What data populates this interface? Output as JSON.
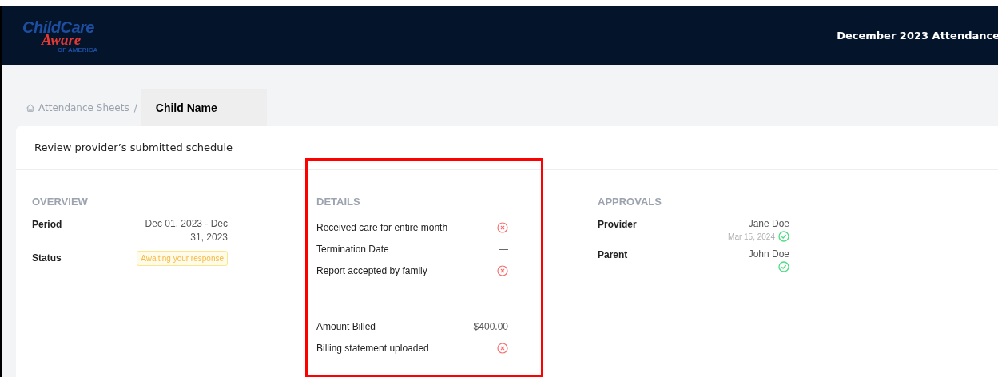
{
  "header": {
    "logo": {
      "line1": "ChildCare",
      "line2": "Aware",
      "line3": "OF AMERICA"
    },
    "title": "December 2023 Attendance"
  },
  "breadcrumb": {
    "parent": "Attendance Sheets",
    "separator": "/",
    "current": "Child Name"
  },
  "card": {
    "title": "Review provider’s submitted schedule"
  },
  "overview": {
    "heading": "OVERVIEW",
    "rows": [
      {
        "kind": "text",
        "label": "Period",
        "value": "Dec 01, 2023 - Dec 31, 2023"
      },
      {
        "kind": "badge",
        "label": "Status",
        "value": "Awaiting your response"
      }
    ]
  },
  "details": {
    "heading": "DETAILS",
    "rows": [
      {
        "kind": "flag",
        "label": "Received care for entire month",
        "checked": false
      },
      {
        "kind": "text",
        "label": "Termination Date",
        "value": "—"
      },
      {
        "kind": "flag",
        "label": "Report accepted by family",
        "checked": false
      },
      {
        "kind": "spacer"
      },
      {
        "kind": "text",
        "label": "Amount Billed",
        "value": "$400.00"
      },
      {
        "kind": "flag",
        "label": "Billing statement uploaded",
        "checked": false
      }
    ]
  },
  "approvals": {
    "heading": "APPROVALS",
    "rows": [
      {
        "label": "Provider",
        "name": "Jane Doe",
        "date": "Mar 15, 2024",
        "approved": true
      },
      {
        "label": "Parent",
        "name": "John Doe",
        "date": "—",
        "approved": true
      }
    ]
  }
}
